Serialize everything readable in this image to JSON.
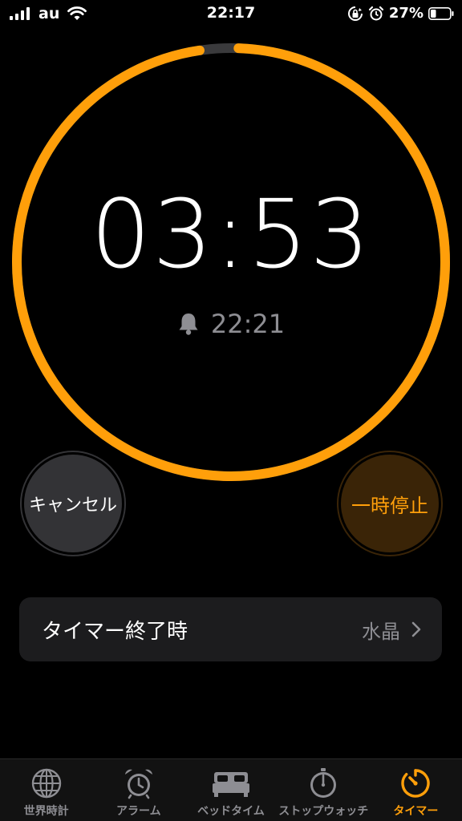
{
  "status_bar": {
    "carrier": "au",
    "time": "22:17",
    "battery_percent": "27%"
  },
  "timer": {
    "remaining": "03:53",
    "end_time": "22:21",
    "progress_fraction": 0.971,
    "ring_color": "#ff9f0a"
  },
  "buttons": {
    "cancel_label": "キャンセル",
    "pause_label": "一時停止"
  },
  "setting": {
    "label": "タイマー終了時",
    "value": "水晶"
  },
  "tabs": [
    {
      "label": "世界時計",
      "icon": "globe-icon",
      "active": false
    },
    {
      "label": "アラーム",
      "icon": "alarm-clock-icon",
      "active": false
    },
    {
      "label": "ベッドタイム",
      "icon": "bed-icon",
      "active": false
    },
    {
      "label": "ストップウォッチ",
      "icon": "stopwatch-icon",
      "active": false
    },
    {
      "label": "タイマー",
      "icon": "timer-icon",
      "active": true
    }
  ],
  "colors": {
    "accent": "#ff9f0a",
    "inactive": "#8e8e93",
    "background": "#000000"
  }
}
